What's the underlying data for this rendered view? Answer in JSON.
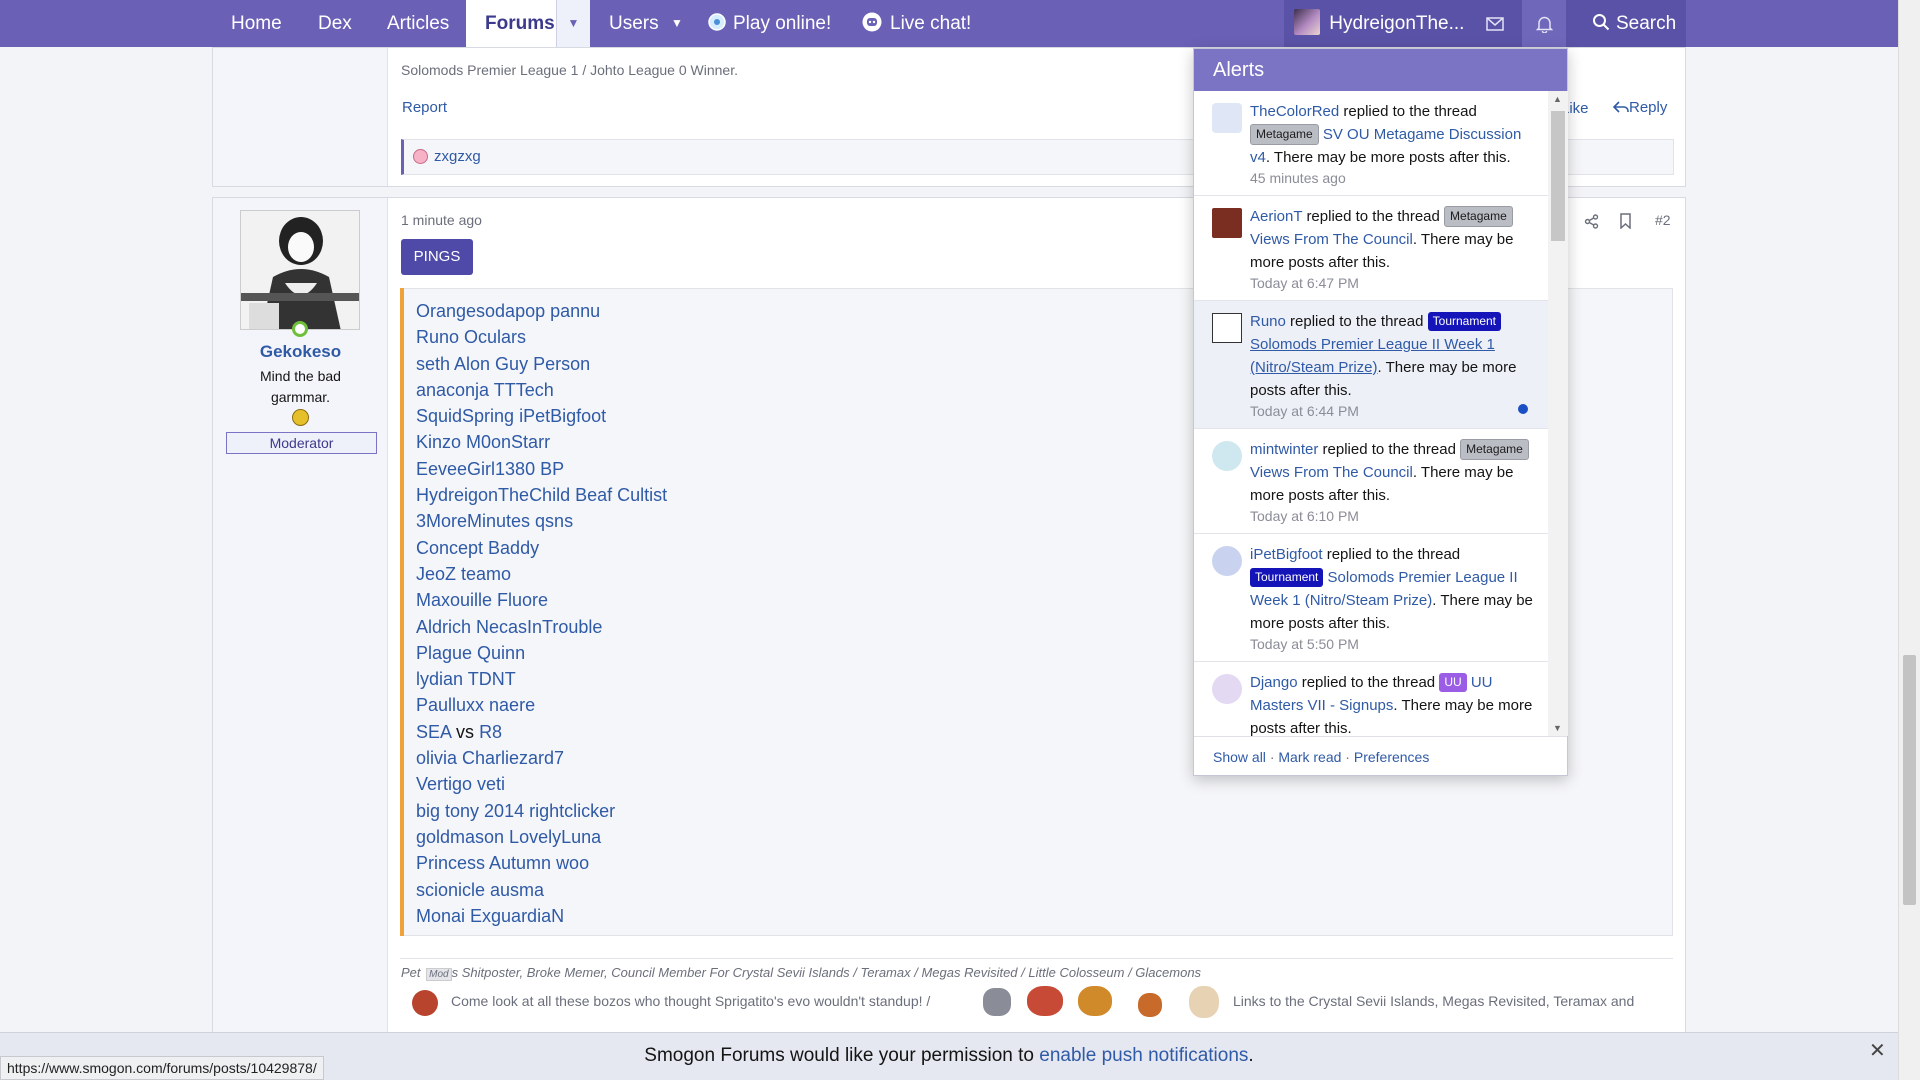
{
  "nav": {
    "home": "Home",
    "dex": "Dex",
    "articles": "Articles",
    "forums": "Forums",
    "users": "Users",
    "play_online": "Play online!",
    "live_chat": "Live chat!",
    "username": "HydreigonThe...",
    "search": "Search"
  },
  "post1": {
    "signature_line": "Solomods Premier League 1 / Johto League 0 Winner.",
    "report": "Report",
    "like": "Like",
    "reply": "Reply",
    "reaction_user": "zxgzxg"
  },
  "post2": {
    "author": "Gekokeso",
    "user_title": "Mind the bad garmmar.",
    "role": "Moderator",
    "timestamp": "1 minute ago",
    "post_number": "#2",
    "pings_button": "PINGS",
    "pings": [
      "Orangesodapop pannu",
      "Runo Oculars",
      "seth Alon Guy Person",
      "anaconja TTTech",
      "SquidSpring iPetBigfoot",
      "Kinzo M0onStarr",
      "EeveeGirl1380 BP",
      "HydreigonTheChild Beaf Cultist",
      "3MoreMinutes qsns",
      "Concept Baddy",
      "JeoZ teamo",
      "Maxouille Fluore",
      "Aldrich NecasInTrouble",
      "Plague Quinn",
      "lydian TDNT",
      "Paulluxx naere",
      "SEA",
      "olivia Charliezard7",
      "Vertigo veti",
      "big tony 2014 rightclicker",
      "goldmason LovelyLuna",
      "Princess Autumn woo",
      "scionicle ausma",
      "Monai ExguardiaN"
    ],
    "ping_vs_word": "vs",
    "ping_vs_right": "R8",
    "sig_pet": "Pet",
    "sig_mod_badge": "Mod",
    "sig_text": "s Shitposter, Broke Memer, Council Member For Crystal Sevii Islands / Teramax / Megas Revisited / Little Colosseum / Glacemons",
    "sig_line2_left": "Come look at all these bozos who thought Sprigatito's evo wouldn't standup! /",
    "sig_line2_right": "Links to the Crystal Sevii Islands, Megas Revisited, Teramax and"
  },
  "alerts": {
    "title": "Alerts",
    "items": [
      {
        "user": "TheColorRed",
        "action": "replied to the thread",
        "tag": "Metagame",
        "tag_kind": "meta",
        "thread": "SV OU Metagame Discussion v4",
        "suffix": ". There may be more posts after this.",
        "time": "45 minutes ago",
        "unread": false
      },
      {
        "user": "AerionT",
        "action": "replied to the thread",
        "tag": "Metagame",
        "tag_kind": "meta",
        "thread": "Views From The Council",
        "suffix": ". There may be more posts after this.",
        "time": "Today at 6:47 PM",
        "unread": false
      },
      {
        "user": "Runo",
        "action": "replied to the thread",
        "tag": "Tournament",
        "tag_kind": "tour",
        "thread": "Solomods Premier League II Week 1 (Nitro/Steam Prize)",
        "suffix": ". There may be more posts after this.",
        "time": "Today at 6:44 PM",
        "unread": true
      },
      {
        "user": "mintwinter",
        "action": "replied to the thread",
        "tag": "Metagame",
        "tag_kind": "meta",
        "thread": "Views From The Council",
        "suffix": ". There may be more posts after this.",
        "time": "Today at 6:10 PM",
        "unread": false
      },
      {
        "user": "iPetBigfoot",
        "action": "replied to the thread",
        "tag": "Tournament",
        "tag_kind": "tour",
        "thread": "Solomods Premier League II Week 1 (Nitro/Steam Prize)",
        "suffix": ". There may be more posts after this.",
        "time": "Today at 5:50 PM",
        "unread": false
      },
      {
        "user": "Django",
        "action": "replied to the thread",
        "tag": "UU",
        "tag_kind": "uu",
        "thread": "UU Masters VII - Signups",
        "suffix": ". There may be more posts after this.",
        "time": "",
        "unread": false
      }
    ],
    "footer": {
      "show_all": "Show all",
      "mark_read": "Mark read",
      "preferences": "Preferences",
      "sep": "·"
    }
  },
  "push": {
    "text": "Smogon Forums would like your permission to",
    "link": "enable push notifications",
    "end": "."
  },
  "status_url": "https://www.smogon.com/forums/posts/10429878/",
  "colors": {
    "nav": "#6a61b6",
    "link": "#2f5aa6",
    "ping_accent": "#f0a23a",
    "tournament": "#1414b8"
  }
}
